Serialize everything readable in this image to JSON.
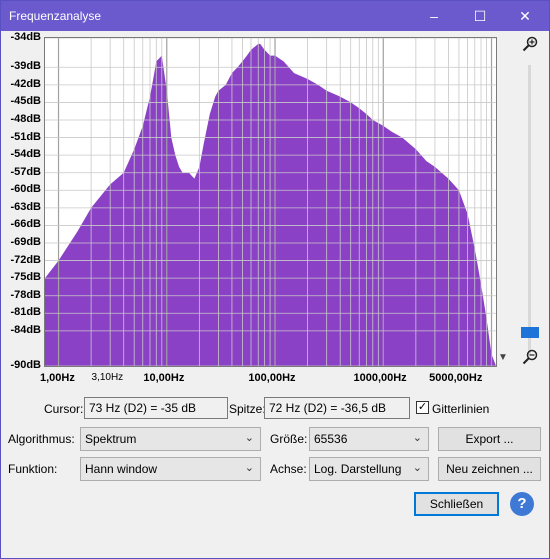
{
  "window": {
    "title": "Frequenzanalyse",
    "controls": [
      "–",
      "☐",
      "✕"
    ]
  },
  "chart_data": {
    "type": "area",
    "x_scale": "log",
    "y_ticks": [
      "-34dB",
      "-39dB",
      "-42dB",
      "-45dB",
      "-48dB",
      "-51dB",
      "-54dB",
      "-57dB",
      "-60dB",
      "-63dB",
      "-66dB",
      "-69dB",
      "-72dB",
      "-75dB",
      "-78dB",
      "-81dB",
      "-84dB",
      "-90dB"
    ],
    "x_ticks": [
      "1,00Hz",
      "3,10Hz",
      "10,00Hz",
      "100,00Hz",
      "1000,00Hz",
      "5000,00Hz"
    ],
    "ylim": [
      -90,
      -34
    ],
    "xlim": [
      0.75,
      11000
    ],
    "grid": true,
    "fill_color": "#8b41c6",
    "spectrum": {
      "freq_hz": [
        0.75,
        1,
        1.5,
        2,
        3,
        4,
        5,
        6,
        7,
        7.5,
        8,
        9,
        10,
        11,
        12,
        13,
        14,
        15,
        16,
        18,
        20,
        22,
        25,
        28,
        30,
        35,
        40,
        45,
        50,
        55,
        60,
        65,
        70,
        73,
        80,
        90,
        100,
        120,
        150,
        200,
        250,
        300,
        400,
        500,
        600,
        700,
        800,
        1000,
        1200,
        1500,
        2000,
        2500,
        3000,
        4000,
        5000,
        6000,
        7000,
        8000,
        9000,
        10000,
        11000
      ],
      "db": [
        -75,
        -72,
        -67,
        -63,
        -59,
        -57,
        -53,
        -49,
        -44,
        -41,
        -38,
        -37,
        -43,
        -51,
        -54,
        -56,
        -57,
        -57,
        -57,
        -58,
        -56,
        -52,
        -47,
        -44,
        -43,
        -42,
        -40,
        -39,
        -38,
        -37,
        -36,
        -35.5,
        -35,
        -35,
        -36,
        -37,
        -37,
        -38,
        -40,
        -41,
        -42,
        -43,
        -44,
        -45,
        -46,
        -47,
        -48,
        -49,
        -50,
        -51,
        -53,
        -55,
        -56,
        -58,
        -60,
        -64,
        -70,
        -76,
        -82,
        -88,
        -92
      ]
    }
  },
  "zoom": {
    "in_icon": "zoom-in-icon",
    "out_icon": "zoom-out-icon",
    "level": 0.92
  },
  "cursor": {
    "label": "Cursor:",
    "value": "73 Hz (D2) = -35 dB"
  },
  "peak": {
    "label": "Spitze:",
    "value": "72 Hz (D2) = -36,5 dB"
  },
  "gridlines": {
    "label": "Gitterlinien",
    "checked": true
  },
  "algorithm": {
    "label": "Algorithmus:",
    "value": "Spektrum"
  },
  "size": {
    "label": "Größe:",
    "value": "65536"
  },
  "export_button": "Export ...",
  "function": {
    "label": "Funktion:",
    "value": "Hann window"
  },
  "axis": {
    "label": "Achse:",
    "value": "Log. Darstellung"
  },
  "redraw_button": "Neu zeichnen ...",
  "close_button": "Schließen",
  "help_button": "?"
}
